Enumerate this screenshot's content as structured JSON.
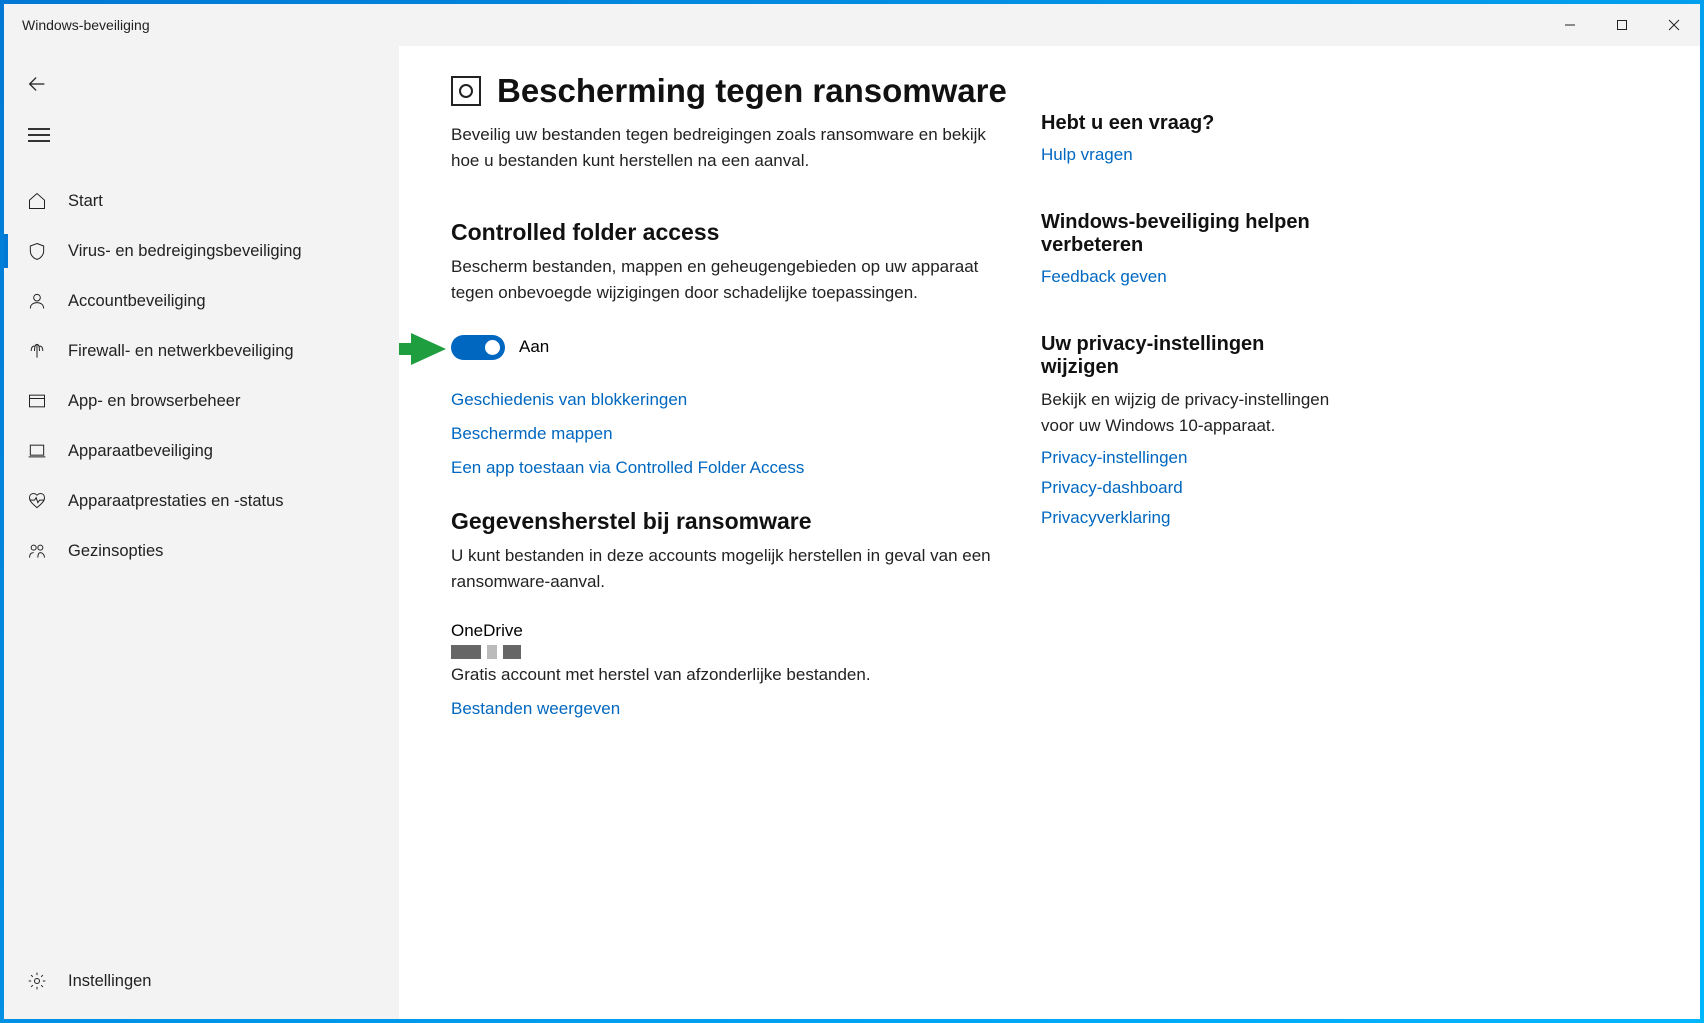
{
  "window": {
    "title": "Windows-beveiliging"
  },
  "sidebar": {
    "items": [
      {
        "label": "Start"
      },
      {
        "label": "Virus- en bedreigingsbeveiliging"
      },
      {
        "label": "Accountbeveiliging"
      },
      {
        "label": "Firewall- en netwerkbeveiliging"
      },
      {
        "label": "App- en browserbeheer"
      },
      {
        "label": "Apparaatbeveiliging"
      },
      {
        "label": "Apparaatprestaties en -status"
      },
      {
        "label": "Gezinsopties"
      }
    ],
    "settings_label": "Instellingen"
  },
  "main": {
    "title": "Bescherming tegen ransomware",
    "desc": "Beveilig uw bestanden tegen bedreigingen zoals ransomware en bekijk hoe u bestanden kunt herstellen na een aanval.",
    "cfa": {
      "title": "Controlled folder access",
      "desc": "Bescherm bestanden, mappen en geheugengebieden op uw apparaat tegen onbevoegde wijzigingen door schadelijke toepassingen.",
      "toggle_state": "Aan",
      "links": {
        "history": "Geschiedenis van blokkeringen",
        "protected": "Beschermde mappen",
        "allow": "Een app toestaan via Controlled Folder Access"
      }
    },
    "recovery": {
      "title": "Gegevensherstel bij ransomware",
      "desc": "U kunt bestanden in deze accounts mogelijk herstellen in geval van een ransomware-aanval.",
      "onedrive_title": "OneDrive",
      "onedrive_desc": "Gratis account met herstel van afzonderlijke bestanden.",
      "onedrive_link": "Bestanden weergeven"
    }
  },
  "aside": {
    "question_title": "Hebt u een vraag?",
    "question_link": "Hulp vragen",
    "improve_title": "Windows-beveiliging helpen verbeteren",
    "improve_link": "Feedback geven",
    "privacy_title": "Uw privacy-instellingen wijzigen",
    "privacy_desc": "Bekijk en wijzig de privacy-instellingen voor uw Windows 10-apparaat.",
    "privacy_links": {
      "settings": "Privacy-instellingen",
      "dashboard": "Privacy-dashboard",
      "statement": "Privacyverklaring"
    }
  }
}
